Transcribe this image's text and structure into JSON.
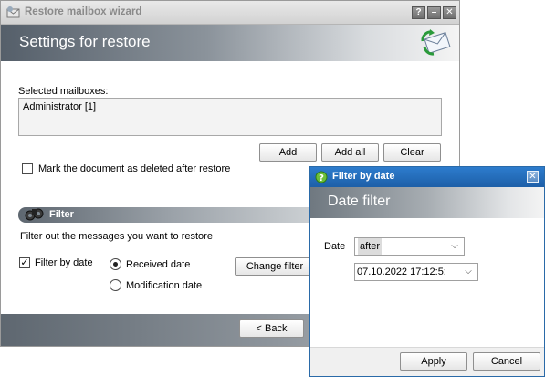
{
  "wizard": {
    "title": "Restore mailbox wizard",
    "header_title": "Settings for restore",
    "controls": {
      "help": "?",
      "minimize": "–",
      "close": "✕"
    },
    "selected_mailboxes_label": "Selected mailboxes:",
    "mailboxes": [
      "Administrator [1]"
    ],
    "buttons": {
      "add": "Add",
      "add_all": "Add all",
      "clear": "Clear",
      "change_filter": "Change filter",
      "back": "< Back"
    },
    "mark_deleted_label": "Mark the document as deleted after restore",
    "mark_deleted_checked": false,
    "filter_section_title": "Filter",
    "filter_description": "Filter out the messages you want to restore",
    "filter_by_date_label": "Filter by date",
    "filter_by_date_checked": true,
    "received_date_label": "Received date",
    "modification_date_label": "Modification date",
    "selected_date_type": "Received date"
  },
  "dialog": {
    "title": "Filter by date",
    "close": "✕",
    "header_title": "Date filter",
    "date_label": "Date",
    "date_mode": "after",
    "date_value": "07.10.2022 17:12:5:",
    "buttons": {
      "apply": "Apply",
      "cancel": "Cancel"
    }
  },
  "colors": {
    "dialog_titlebar": "#1d5fa8",
    "header_gradient_dark": "#555f6a"
  }
}
